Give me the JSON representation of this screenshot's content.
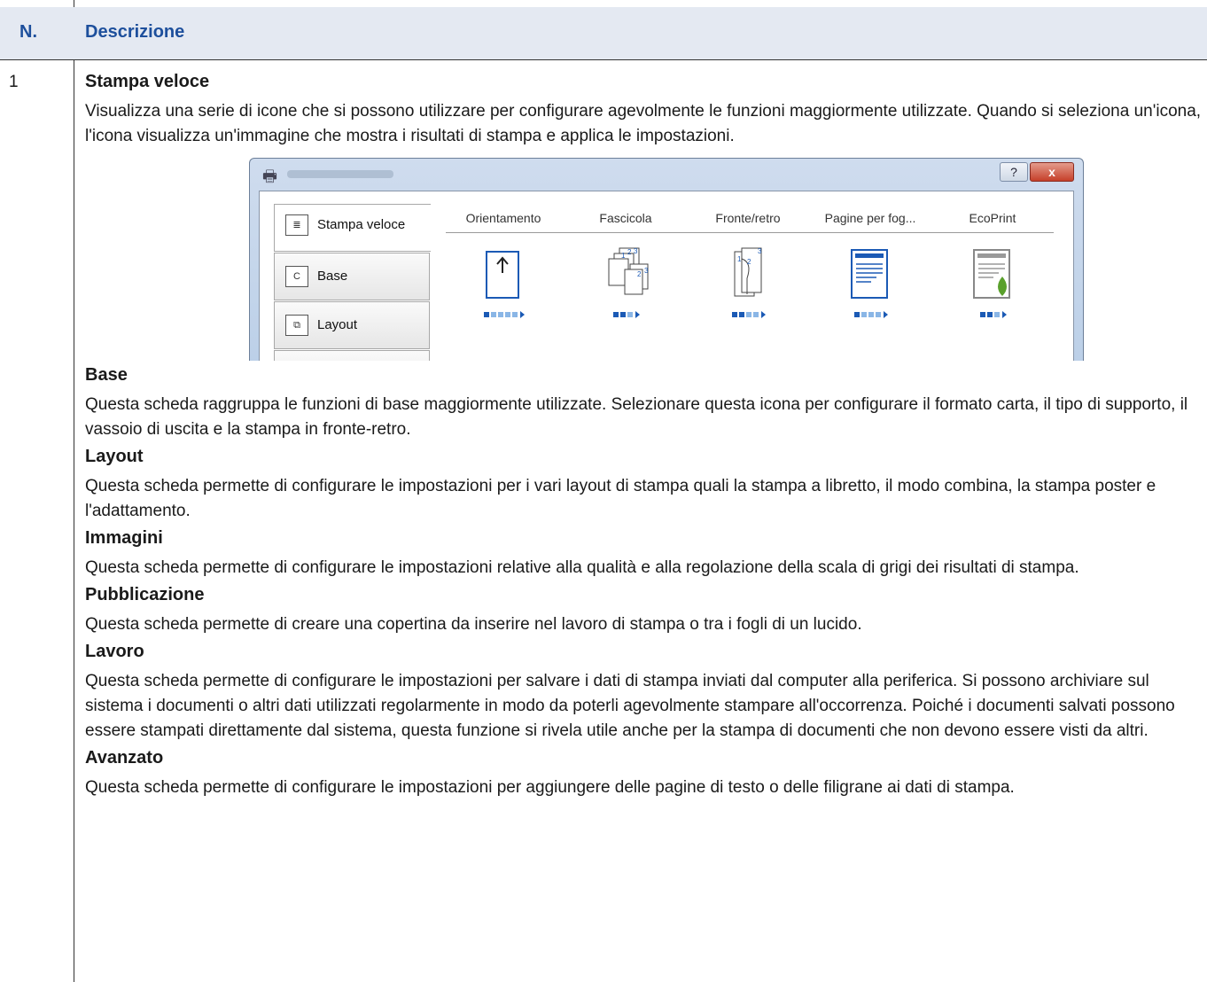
{
  "table": {
    "header": {
      "col1": "N.",
      "col2": "Descrizione"
    },
    "row_number": "1",
    "sections": [
      {
        "title": "Stampa veloce",
        "text": "Visualizza una serie di icone che si possono utilizzare per configurare agevolmente le funzioni maggiormente utilizzate. Quando si seleziona un'icona, l'icona visualizza un'immagine che mostra i risultati di stampa e applica le impostazioni."
      },
      {
        "title": "Base",
        "text": "Questa scheda raggruppa le funzioni di base maggiormente utilizzate. Selezionare questa icona per configurare il formato carta, il tipo di supporto, il vassoio di uscita e la stampa in fronte-retro."
      },
      {
        "title": "Layout",
        "text": "Questa scheda permette di configurare le impostazioni per i vari layout di stampa quali la stampa a libretto, il modo combina, la stampa poster e l'adattamento."
      },
      {
        "title": "Immagini",
        "text": "Questa scheda permette di configurare le impostazioni relative alla qualità e alla regolazione della scala di grigi dei risultati di stampa."
      },
      {
        "title": "Pubblicazione",
        "text": "Questa scheda permette di creare una copertina da inserire nel lavoro di stampa o tra i fogli di un lucido."
      },
      {
        "title": "Lavoro",
        "text": "Questa scheda permette di configurare le impostazioni per salvare i dati di stampa inviati dal computer alla periferica. Si possono archiviare sul sistema i documenti o altri dati utilizzati regolarmente in modo da poterli agevolmente stampare all'occorrenza. Poiché i documenti salvati possono essere stampati direttamente dal sistema, questa funzione si rivela utile anche per la stampa di documenti che non devono essere visti da altri."
      },
      {
        "title": "Avanzato",
        "text": "Questa scheda permette di configurare le impostazioni per aggiungere delle pagine di testo o delle filigrane ai dati di stampa."
      }
    ]
  },
  "dialog": {
    "help_label": "?",
    "close_label": "x",
    "tabs": [
      {
        "label": "Stampa veloce",
        "icon": "quick-print-icon",
        "icon_glyph": "≣"
      },
      {
        "label": "Base",
        "icon": "basic-icon",
        "icon_glyph": "C"
      },
      {
        "label": "Layout",
        "icon": "layout-icon",
        "icon_glyph": "⧉"
      }
    ],
    "quick_items": [
      {
        "label": "Orientamento",
        "icon": "orientation-icon",
        "levels": 5,
        "active": 1
      },
      {
        "label": "Fascicola",
        "icon": "collate-icon",
        "levels": 3,
        "active": 2
      },
      {
        "label": "Fronte/retro",
        "icon": "duplex-icon",
        "levels": 4,
        "active": 2
      },
      {
        "label": "Pagine per fog...",
        "icon": "pages-per-sheet-icon",
        "levels": 4,
        "active": 1
      },
      {
        "label": "EcoPrint",
        "icon": "ecoprint-icon",
        "levels": 3,
        "active": 2
      }
    ]
  }
}
